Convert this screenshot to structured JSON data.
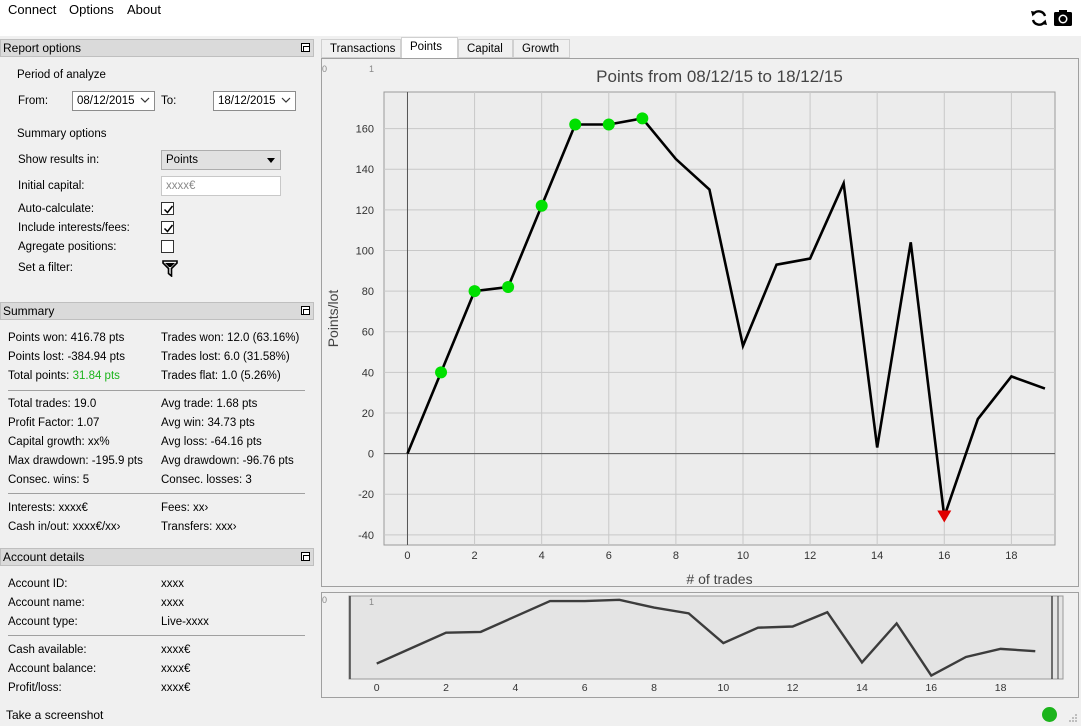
{
  "menu": {
    "connect": "Connect",
    "options": "Options",
    "about": "About"
  },
  "toolbar": {
    "refresh_icon": "refresh-icon",
    "screenshot_icon": "camera-icon"
  },
  "report_options": {
    "header": "Report options",
    "period_label": "Period of analyze",
    "from_label": "From:",
    "from_value": "08/12/2015",
    "to_label": "To:",
    "to_value": "18/12/2015",
    "summary_options_label": "Summary options",
    "show_results_label": "Show results in:",
    "show_results_value": "Points",
    "initial_capital_label": "Initial capital:",
    "initial_capital_placeholder": "xxxx€",
    "auto_calculate_label": "Auto-calculate:",
    "auto_calculate": true,
    "include_interests_label": "Include interests/fees:",
    "include_interests": true,
    "aggregate_label": "Agregate positions:",
    "aggregate": false,
    "filter_label": "Set a filter:"
  },
  "summary": {
    "header": "Summary",
    "points_won": "Points won: 416.78 pts",
    "points_lost": "Points lost: -384.94 pts",
    "total_points_label": "Total points: ",
    "total_points_value": "31.84 pts",
    "trades_won": "Trades won: 12.0 (63.16%)",
    "trades_lost": "Trades lost: 6.0 (31.58%)",
    "trades_flat": "Trades flat: 1.0 (5.26%)",
    "total_trades": "Total trades: 19.0",
    "profit_factor": "Profit Factor: 1.07",
    "capital_growth": "Capital growth: xx%",
    "max_drawdown": "Max drawdown: -195.9 pts",
    "consec_wins": "Consec. wins: 5",
    "avg_trade": "Avg trade: 1.68 pts",
    "avg_win": "Avg win: 34.73 pts",
    "avg_loss": "Avg loss: -64.16 pts",
    "avg_drawdown": "Avg drawdown: -96.76 pts",
    "consec_losses": "Consec. losses: 3",
    "interests": "Interests: xxxx€",
    "cash_in_out": "Cash in/out: xxxx€/xx›",
    "fees": "Fees: xx›",
    "transfers": "Transfers: xxx›"
  },
  "account": {
    "header": "Account details",
    "id_label": "Account ID:",
    "id_value": "xxxx",
    "name_label": "Account name:",
    "name_value": "xxxx",
    "type_label": "Account type:",
    "type_value": "Live-xxxx",
    "cash_label": "Cash available:",
    "cash_value": "xxxx€",
    "balance_label": "Account balance:",
    "balance_value": "xxxx€",
    "pl_label": "Profit/loss:",
    "pl_value": "xxxx€"
  },
  "screenshot_link": "Take a screenshot",
  "tabs": [
    "Transactions",
    "Points",
    "Capital",
    "Growth"
  ],
  "active_tab": 1,
  "colors": {
    "win_marker": "#00e000",
    "loss_marker": "#e00000",
    "total_points": "#1cb41c",
    "status": "#1cb41c"
  },
  "chart_data": [
    {
      "type": "line",
      "title": "Points from 08/12/15 to 18/12/15",
      "xlabel": "# of trades",
      "ylabel": "Points/lot",
      "x": [
        0,
        1,
        2,
        3,
        4,
        5,
        6,
        7,
        8,
        9,
        10,
        11,
        12,
        13,
        14,
        15,
        16,
        17,
        18,
        19
      ],
      "values": [
        0,
        40,
        80,
        82,
        122,
        162,
        162,
        165,
        145,
        130,
        53,
        93,
        96,
        133,
        3,
        104,
        -31,
        17,
        38,
        32
      ],
      "xlim": [
        -0.7,
        19.3
      ],
      "ylim": [
        -45,
        178
      ],
      "xticks": [
        0,
        2,
        4,
        6,
        8,
        10,
        12,
        14,
        16,
        18
      ],
      "yticks": [
        -40,
        -20,
        0,
        20,
        40,
        60,
        80,
        100,
        120,
        140,
        160
      ],
      "win_streak_indices": [
        1,
        2,
        3,
        4,
        5,
        6,
        7
      ],
      "min_index": 16,
      "grid": true,
      "corner_labels": [
        "0",
        "1"
      ]
    },
    {
      "type": "line",
      "title": "",
      "xticks": [
        0,
        2,
        4,
        6,
        8,
        10,
        12,
        14,
        16,
        18
      ],
      "values": [
        0,
        40,
        80,
        82,
        122,
        162,
        162,
        165,
        145,
        130,
        53,
        93,
        96,
        133,
        3,
        104,
        -31,
        17,
        38,
        32
      ],
      "xlim": [
        -0.8,
        19.8
      ],
      "ylim": [
        -40,
        175
      ],
      "corner_labels": [
        "0",
        "1"
      ]
    }
  ]
}
